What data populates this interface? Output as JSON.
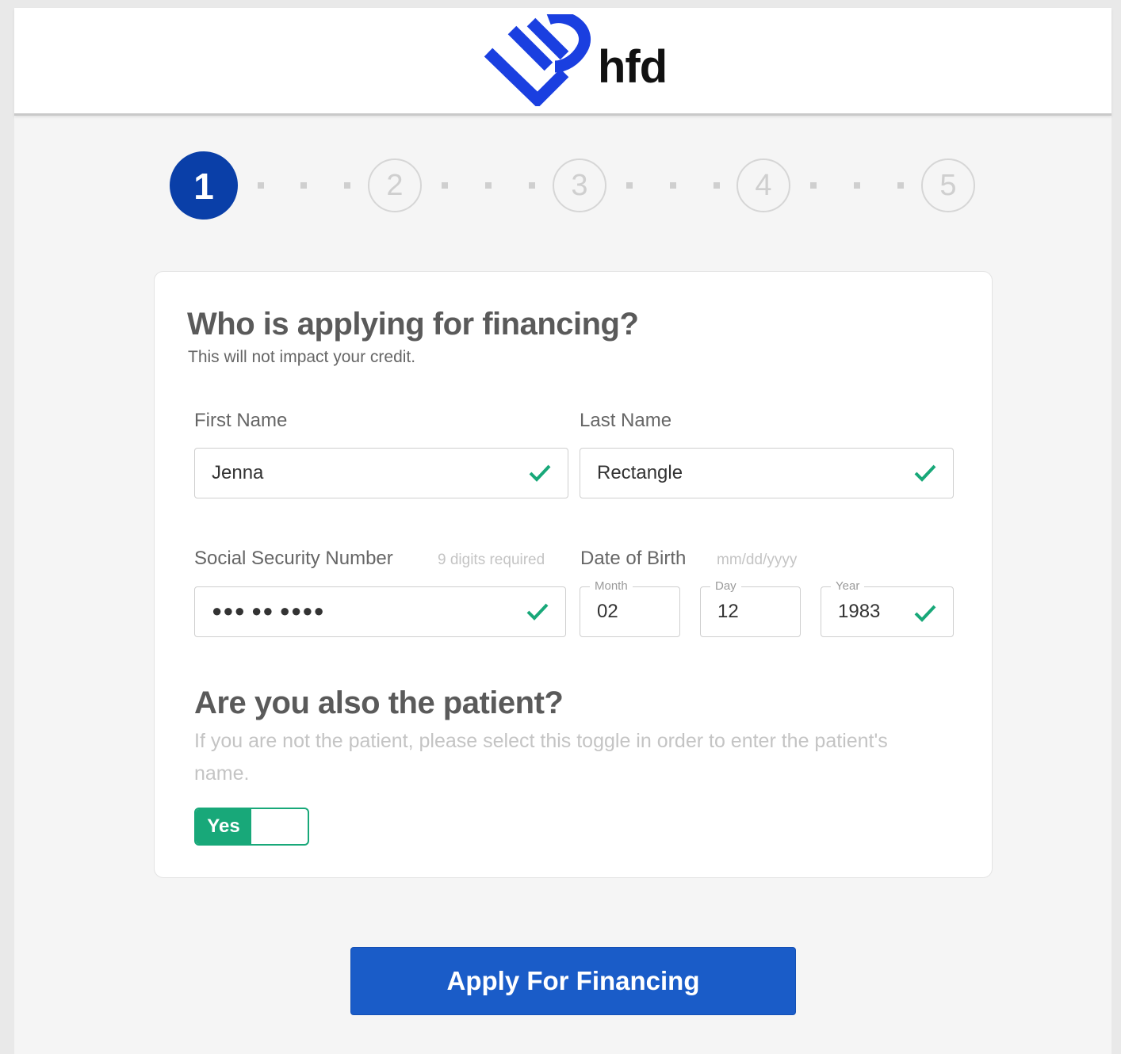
{
  "brand": {
    "name": "hfd",
    "logo_color": "#1a3fe0"
  },
  "stepper": {
    "steps": [
      "1",
      "2",
      "3",
      "4",
      "5"
    ],
    "active_step": 1,
    "active_color": "#0a3fa8"
  },
  "form": {
    "title": "Who is applying for financing?",
    "subtitle": "This will not impact your credit.",
    "first_name": {
      "label": "First Name",
      "value": "Jenna",
      "valid": true
    },
    "last_name": {
      "label": "Last Name",
      "value": "Rectangle",
      "valid": true
    },
    "ssn": {
      "label": "Social Security Number",
      "hint": "9 digits required",
      "value": "●●● ●● ●●●●",
      "valid": true
    },
    "dob": {
      "label": "Date of Birth",
      "hint": "mm/dd/yyyy",
      "month": {
        "legend": "Month",
        "value": "02"
      },
      "day": {
        "legend": "Day",
        "value": "12"
      },
      "year": {
        "legend": "Year",
        "value": "1983"
      },
      "valid": true
    },
    "patient": {
      "title": "Are you also the patient?",
      "description": "If you are not the patient, please select this toggle in order to enter the patient's name.",
      "toggle_label": "Yes",
      "toggle_on": true,
      "toggle_color": "#18a879"
    }
  },
  "submit": {
    "label": "Apply For Financing",
    "color": "#1a5cc8"
  },
  "icons": {
    "valid": "check-icon"
  }
}
